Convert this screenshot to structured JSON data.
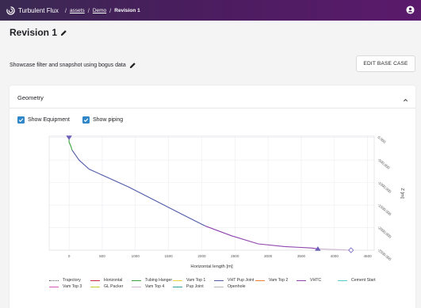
{
  "header": {
    "brand": "Turbulent Flux",
    "sep": "/",
    "crumbs": [
      "assets",
      "Demo"
    ],
    "current": "Revision 1"
  },
  "page": {
    "title": "Revision 1",
    "subtitle": "Showcase filter and snapshot using bogus data",
    "edit_button": "EDIT BASE CASE"
  },
  "geometry": {
    "title": "Geometry",
    "show_equipment": {
      "label": "Show Equipment",
      "checked": true
    },
    "show_piping": {
      "label": "Show piping",
      "checked": true
    }
  },
  "chart_data": {
    "type": "line",
    "xlabel": "Horizontal length [m]",
    "ylabel": "Z [m]",
    "x_ticks": [
      "0",
      "500",
      "1000",
      "1500",
      "2000",
      "2500",
      "3000",
      "3500",
      "4000",
      "4500"
    ],
    "y_ticks": [
      "0.000",
      "-500.000",
      "-1000.000",
      "-1500.000",
      "-2000.000",
      "-2500.000"
    ],
    "xlim": [
      -300,
      4600
    ],
    "ylim": [
      -2500,
      30
    ],
    "grid": true,
    "series": [
      {
        "name": "Tubing Hanger",
        "color": "#3aa53a",
        "x": [
          0,
          0,
          30,
          45
        ],
        "y": [
          0,
          -100,
          -200,
          -280
        ]
      },
      {
        "name": "VHT Pup Joint",
        "color": "#4e5aa6",
        "x": [
          45,
          150,
          300,
          600,
          900,
          1300,
          1700,
          2050
        ],
        "y": [
          -280,
          -500,
          -700,
          -900,
          -1100,
          -1400,
          -1700,
          -1960
        ]
      },
      {
        "name": "VHTC",
        "color": "#8e44ad",
        "x": [
          2050,
          2450,
          2850,
          3250,
          3650,
          3750
        ],
        "y": [
          -1960,
          -2180,
          -2360,
          -2420,
          -2450,
          -2470
        ]
      },
      {
        "name": "Vam Top 4",
        "color": "#cfb7cf",
        "x": [
          3750,
          3950,
          4100,
          4250
        ],
        "y": [
          -2470,
          -2480,
          -2490,
          -2500
        ]
      }
    ],
    "markers": [
      {
        "shape": "triangle-down",
        "color": "#6c5fb8",
        "x": 0,
        "y": 0
      },
      {
        "shape": "triangle-up",
        "color": "#6c5fb8",
        "x": 3750,
        "y": -2470
      },
      {
        "shape": "diamond",
        "color": "#6c5fb8",
        "x": 4250,
        "y": -2500
      }
    ],
    "legend": [
      {
        "label": "Trajectory",
        "color": "#555555",
        "dash": true
      },
      {
        "label": "Horizontal",
        "color": "#c8283c"
      },
      {
        "label": "Tubing Hanger",
        "color": "#3aa53a"
      },
      {
        "label": "Vam Top 1",
        "color": "#e6d23a"
      },
      {
        "label": "VHT Pup Joint",
        "color": "#4e5aa6"
      },
      {
        "label": "Vam Top 2",
        "color": "#e8803a"
      },
      {
        "label": "VHTC",
        "color": "#8e44ad"
      },
      {
        "label": "Cement Start",
        "color": "#56c8c8"
      },
      {
        "label": "Vam Top 3",
        "color": "#d65ab8"
      },
      {
        "label": "GL Packer",
        "color": "#c8c83a"
      },
      {
        "label": "Vam Top 4",
        "color": "#d2b4d2"
      },
      {
        "label": "Pup Joint",
        "color": "#3aa0a0"
      },
      {
        "label": "Openhole",
        "color": "#b4b4b4"
      }
    ]
  }
}
